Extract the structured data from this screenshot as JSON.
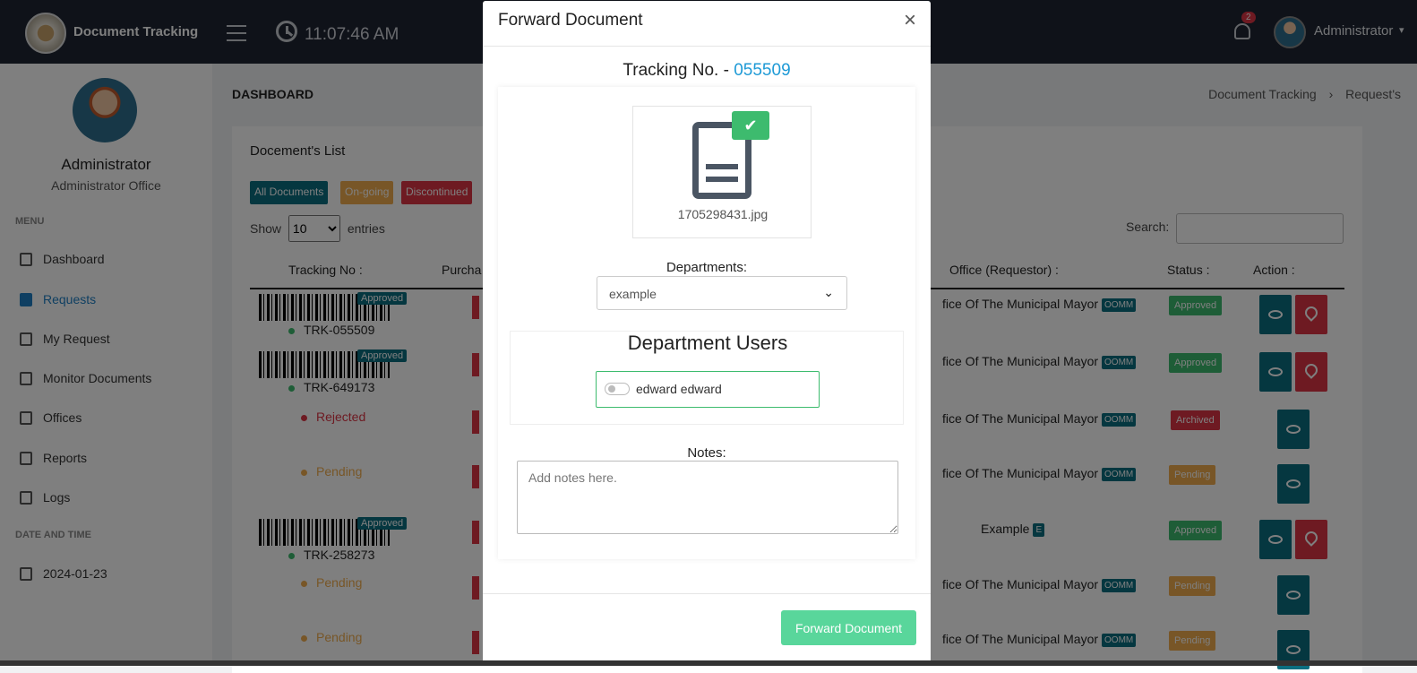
{
  "topbar": {
    "brand": "Document Tracking",
    "time": "11:07:46 AM",
    "notif_count": "2",
    "user": "Administrator"
  },
  "sidebar": {
    "name": "Administrator",
    "office": "Administrator Office",
    "menu_heading": "MENU",
    "items": [
      {
        "label": "Dashboard",
        "icon": "grid-icon"
      },
      {
        "label": "Requests",
        "icon": "file-icon",
        "active": true
      },
      {
        "label": "My Request",
        "icon": "file-icon"
      },
      {
        "label": "Monitor Documents",
        "icon": "file-icon"
      },
      {
        "label": "Offices",
        "icon": "building-icon"
      },
      {
        "label": "Reports",
        "icon": "bar-chart-icon"
      },
      {
        "label": "Logs",
        "icon": "history-icon"
      }
    ],
    "date_heading": "DATE AND TIME",
    "date": "2024-01-23"
  },
  "main": {
    "title": "DASHBOARD",
    "breadcrumb": [
      "Document Tracking",
      "Request's"
    ],
    "card_title": "Docement's List",
    "filters": [
      {
        "label": "All Documents",
        "color": "#0b6e80"
      },
      {
        "label": "On-going",
        "color": "#f0ad4e"
      },
      {
        "label": "Discontinued",
        "color": "#dc3545"
      }
    ],
    "show_label": "Show",
    "show_value": "10",
    "entries_label": "entries",
    "search_label": "Search:",
    "columns": [
      "Tracking No :",
      "Purcha",
      "Office (Requestor) :",
      "Status :",
      "Action :"
    ],
    "rows": [
      {
        "barcode": true,
        "badge": "Approved",
        "tracking": "TRK-055509",
        "office": "fice Of The Municipal Mayor",
        "tag": "OOMM",
        "status": "Approved",
        "actions": 2
      },
      {
        "barcode": true,
        "badge": "Approved",
        "tracking": "TRK-649173",
        "office": "fice Of The Municipal Mayor",
        "tag": "OOMM",
        "status": "Approved",
        "actions": 2
      },
      {
        "barcode": false,
        "tracking": "Rejected",
        "office": "fice Of The Municipal Mayor",
        "tag": "OOMM",
        "status": "Archived",
        "actions": 1
      },
      {
        "barcode": false,
        "tracking": "Pending",
        "office": "fice Of The Municipal Mayor",
        "tag": "OOMM",
        "status": "Pending",
        "actions": 1
      },
      {
        "barcode": true,
        "badge": "Approved",
        "tracking": "TRK-258273",
        "office": "Example",
        "tag": "E",
        "status": "Approved",
        "actions": 2
      },
      {
        "barcode": false,
        "tracking": "Pending",
        "office": "fice Of The Municipal Mayor",
        "tag": "OOMM",
        "status": "Pending",
        "actions": 1
      },
      {
        "barcode": false,
        "tracking": "Pending",
        "office": "fice Of The Municipal Mayor",
        "tag": "OOMM",
        "status": "Pending",
        "actions": 1
      }
    ]
  },
  "modal": {
    "title": "Forward Document",
    "tracking_label": "Tracking No. -",
    "tracking_number": "055509",
    "file_name": "1705298431.jpg",
    "departments_label": "Departments:",
    "department_selected": "example",
    "users_title": "Department Users",
    "user": "edward edward",
    "notes_label": "Notes:",
    "notes_placeholder": "Add notes here.",
    "submit_label": "Forward Document"
  },
  "colors": {
    "approved": "#3dbb6e",
    "pending": "#f0ad4e",
    "archived": "#dc3545",
    "primary": "#0b6e80"
  }
}
